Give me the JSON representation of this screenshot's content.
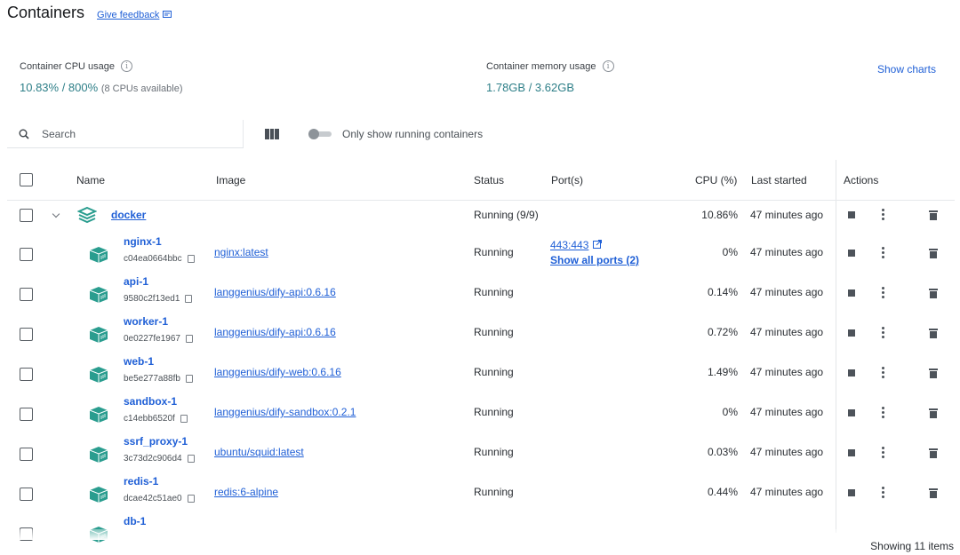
{
  "header": {
    "title": "Containers",
    "feedback": "Give feedback"
  },
  "stats": {
    "cpu_label": "Container CPU usage",
    "cpu_value": "10.83% / 800%",
    "cpu_sub": "(8 CPUs available)",
    "mem_label": "Container memory usage",
    "mem_value": "1.78GB / 3.62GB",
    "show_charts": "Show charts"
  },
  "toolbar": {
    "search_placeholder": "Search",
    "toggle_label": "Only show running containers",
    "toggle_on": false
  },
  "table": {
    "headers": {
      "name": "Name",
      "image": "Image",
      "status": "Status",
      "ports": "Port(s)",
      "cpu": "CPU (%)",
      "started": "Last started",
      "actions": "Actions"
    },
    "group": {
      "name": "docker",
      "status": "Running (9/9)",
      "cpu": "10.86%",
      "started": "47 minutes ago"
    },
    "rows": [
      {
        "name": "nginx-1",
        "id": "c04ea0664bbc",
        "image": "nginx:latest",
        "status": "Running",
        "port": "443:443",
        "ports_link": "Show all ports (2)",
        "cpu": "0%",
        "started": "47 minutes ago"
      },
      {
        "name": "api-1",
        "id": "9580c2f13ed1",
        "image": "langgenius/dify-api:0.6.16",
        "status": "Running",
        "port": "",
        "ports_link": "",
        "cpu": "0.14%",
        "started": "47 minutes ago"
      },
      {
        "name": "worker-1",
        "id": "0e0227fe1967",
        "image": "langgenius/dify-api:0.6.16",
        "status": "Running",
        "port": "",
        "ports_link": "",
        "cpu": "0.72%",
        "started": "47 minutes ago"
      },
      {
        "name": "web-1",
        "id": "be5e277a88fb",
        "image": "langgenius/dify-web:0.6.16",
        "status": "Running",
        "port": "",
        "ports_link": "",
        "cpu": "1.49%",
        "started": "47 minutes ago"
      },
      {
        "name": "sandbox-1",
        "id": "c14ebb6520f",
        "image": "langgenius/dify-sandbox:0.2.1",
        "status": "Running",
        "port": "",
        "ports_link": "",
        "cpu": "0%",
        "started": "47 minutes ago"
      },
      {
        "name": "ssrf_proxy-1",
        "id": "3c73d2c906d4",
        "image": "ubuntu/squid:latest",
        "status": "Running",
        "port": "",
        "ports_link": "",
        "cpu": "0.03%",
        "started": "47 minutes ago"
      },
      {
        "name": "redis-1",
        "id": "dcae42c51ae0",
        "image": "redis:6-alpine",
        "status": "Running",
        "port": "",
        "ports_link": "",
        "cpu": "0.44%",
        "started": "47 minutes ago"
      },
      {
        "name": "db-1",
        "id": "",
        "image": "",
        "status": "",
        "port": "",
        "ports_link": "",
        "cpu": "",
        "started": ""
      }
    ]
  },
  "footer": {
    "showing": "Showing 11 items"
  },
  "colors": {
    "accent": "#1f5fd6",
    "container_icon": "#2a9d8f",
    "stat_value": "#2e7f88"
  }
}
